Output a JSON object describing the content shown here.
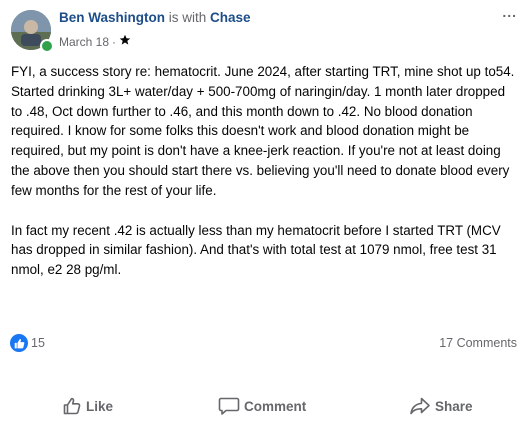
{
  "header": {
    "author": "Ben Washington",
    "with_text": "is with",
    "tagged": "Chase",
    "date": "March 18",
    "separator": "·",
    "privacy_icon": "star-icon",
    "more_label": "..."
  },
  "body": {
    "paragraph1": "FYI, a success story re: hematocrit. June 2024, after starting TRT, mine shot up to54. Started drinking 3L+ water/day + 500-700mg of naringin/day. 1 month later dropped to .48, Oct down further to .46, and this month down to .42. No blood donation required. I know for some folks this doesn't work and blood donation might be required, but my point is don't have a knee-jerk reaction. If you're not at least doing the above then you should start there vs. believing you'll need to donate blood every few months for the rest of your life.",
    "paragraph2": "In fact my recent .42 is actually less than my hematocrit before I started TRT (MCV has dropped in similar fashion). And that's with total test at 1079 nmol, free test 31 nmol, e2 28 pg/ml."
  },
  "stats": {
    "like_count": "15",
    "comment_count": "17 Comments"
  },
  "actions": {
    "like_label": "Like",
    "comment_label": "Comment",
    "share_label": "Share"
  },
  "colors": {
    "author": "#1d4e89",
    "muted": "#65676b",
    "like_blue": "#1877f2",
    "online": "#31a24c"
  }
}
